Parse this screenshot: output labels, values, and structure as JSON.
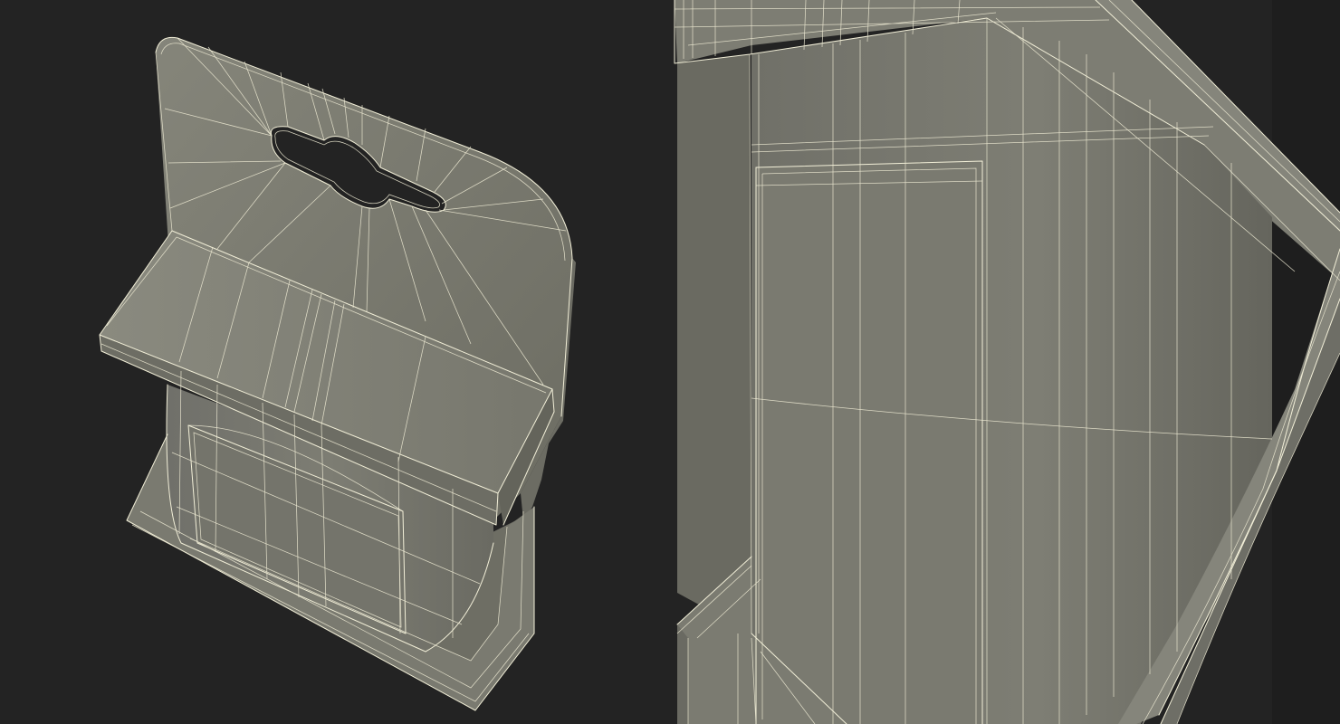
{
  "scene": {
    "background": "#232323",
    "mesh_color": "#7b7b70",
    "mesh_shadow": "#5f5f56",
    "mesh_highlight": "#8a8a7f",
    "wire_color": "#f2efd8"
  },
  "views": [
    {
      "id": "left",
      "subject": "hang-tab-package-wireframe"
    },
    {
      "id": "right",
      "subject": "package-closeup-wireframe"
    }
  ]
}
